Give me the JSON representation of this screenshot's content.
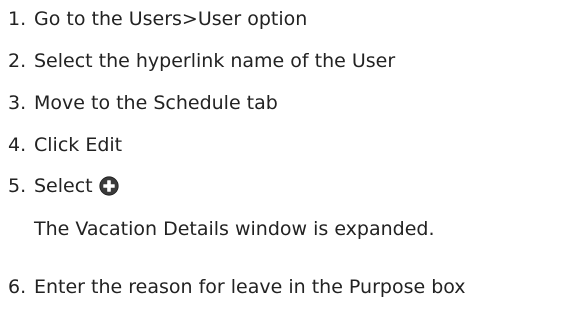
{
  "steps": [
    {
      "number": "1.",
      "text": "Go to the Users>User option"
    },
    {
      "number": "2.",
      "text": "Select the hyperlink name of the User"
    },
    {
      "number": "3.",
      "text": "Move to the Schedule tab"
    },
    {
      "number": "4.",
      "text": "Click Edit"
    },
    {
      "number": "5.",
      "text": "Select",
      "icon": "plus-circle-icon"
    },
    {
      "number": "6.",
      "text": "Enter the reason for leave in the Purpose box"
    }
  ],
  "note_after_step_5": "The Vacation Details window is expanded.",
  "colors": {
    "text": "#222222",
    "icon_fill": "#3a3a3a",
    "background": "#ffffff"
  }
}
